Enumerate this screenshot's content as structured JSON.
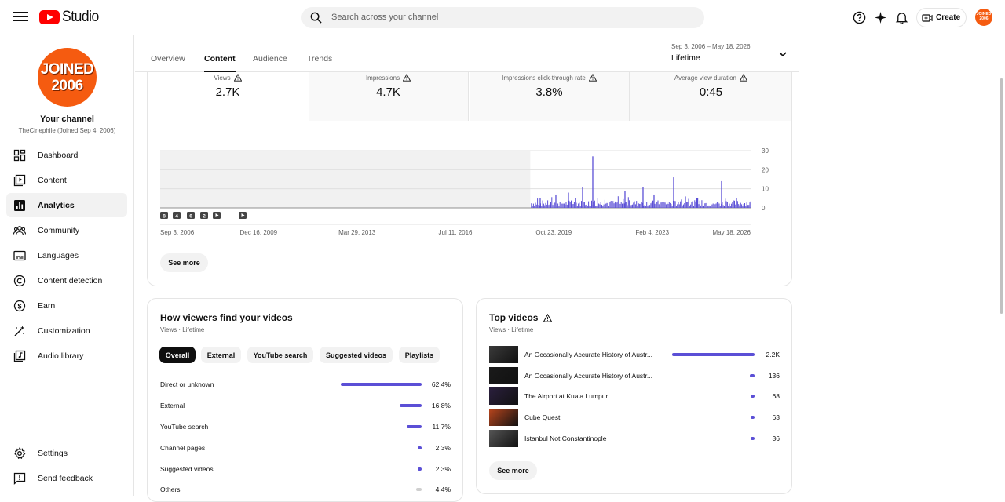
{
  "header": {
    "app_name": "Studio",
    "search_placeholder": "Search across your channel",
    "create_label": "Create",
    "avatar_text": "JOINED 2006"
  },
  "sidebar": {
    "avatar_line1": "JOINED",
    "avatar_line2": "2006",
    "title": "Your channel",
    "subtitle": "TheCinephile (Joined Sep 4, 2006)",
    "items": [
      {
        "label": "Dashboard",
        "icon": "dashboard-icon"
      },
      {
        "label": "Content",
        "icon": "content-icon"
      },
      {
        "label": "Analytics",
        "icon": "analytics-icon",
        "active": true
      },
      {
        "label": "Community",
        "icon": "community-icon"
      },
      {
        "label": "Languages",
        "icon": "languages-icon"
      },
      {
        "label": "Content detection",
        "icon": "copyright-icon"
      },
      {
        "label": "Earn",
        "icon": "earn-icon"
      },
      {
        "label": "Customization",
        "icon": "customization-icon"
      },
      {
        "label": "Audio library",
        "icon": "audio-library-icon"
      }
    ],
    "bottom": [
      {
        "label": "Settings",
        "icon": "settings-icon"
      },
      {
        "label": "Send feedback",
        "icon": "feedback-icon"
      }
    ]
  },
  "tabs": [
    "Overview",
    "Content",
    "Audience",
    "Trends"
  ],
  "active_tab": "Content",
  "date_range": {
    "range": "Sep 3, 2006 – May 18, 2026",
    "label": "Lifetime"
  },
  "metrics": [
    {
      "label": "Views",
      "value": "2.7K"
    },
    {
      "label": "Impressions",
      "value": "4.7K"
    },
    {
      "label": "Impressions click-through rate",
      "value": "3.8%"
    },
    {
      "label": "Average view duration",
      "value": "0:45"
    }
  ],
  "chart_data": {
    "type": "bar",
    "series": [
      {
        "name": "Views"
      }
    ],
    "x_ticks": [
      "Sep 3, 2006",
      "Dec 16, 2009",
      "Mar 29, 2013",
      "Jul 11, 2016",
      "Oct 23, 2019",
      "Feb 4, 2023",
      "May 18, 2026"
    ],
    "y_ticks": [
      30,
      20,
      10,
      0
    ],
    "ylim": [
      0,
      30
    ],
    "data_start": "Oct 23, 2019",
    "spikes": [
      {
        "date": "Nov 2019",
        "value": 5
      },
      {
        "date": "Feb 2020",
        "value": 7
      },
      {
        "date": "Nov 2020",
        "value": 8
      },
      {
        "date": "Apr 2021",
        "value": 11
      },
      {
        "date": "Oct 2021",
        "value": 27
      },
      {
        "date": "Dec 2022",
        "value": 9
      },
      {
        "date": "Aug 2023",
        "value": 11
      },
      {
        "date": "Feb 2024",
        "value": 7
      },
      {
        "date": "Jun 2024",
        "value": 16
      },
      {
        "date": "Nov 2024",
        "value": 6
      },
      {
        "date": "Mar 2025",
        "value": 5
      },
      {
        "date": "Aug 2025",
        "value": 14
      },
      {
        "date": "Jan 2026",
        "value": 5
      }
    ],
    "baseline_typical": 2,
    "markers": [
      "8",
      "4",
      "6",
      "2"
    ],
    "grid": true
  },
  "main_see_more": "See more",
  "traffic": {
    "title": "How viewers find your videos",
    "subtitle": "Views · Lifetime",
    "chips": [
      "Overall",
      "External",
      "YouTube search",
      "Suggested videos",
      "Playlists"
    ],
    "active_chip": "Overall",
    "rows": [
      {
        "label": "Direct or unknown",
        "pct": "62.4%",
        "value": 62.4
      },
      {
        "label": "External",
        "pct": "16.8%",
        "value": 16.8
      },
      {
        "label": "YouTube search",
        "pct": "11.7%",
        "value": 11.7
      },
      {
        "label": "Channel pages",
        "pct": "2.3%",
        "value": 2.3
      },
      {
        "label": "Suggested videos",
        "pct": "2.3%",
        "value": 2.3
      },
      {
        "label": "Others",
        "pct": "4.4%",
        "value": 4.4,
        "grey": true
      }
    ]
  },
  "top_videos": {
    "title": "Top videos",
    "subtitle": "Views · Lifetime",
    "rows": [
      {
        "title": "An Occasionally Accurate History of Austr...",
        "views": "2.2K",
        "value": 2200
      },
      {
        "title": "An Occasionally Accurate History of Austr...",
        "views": "136",
        "value": 136
      },
      {
        "title": "The Airport at Kuala Lumpur",
        "views": "68",
        "value": 68
      },
      {
        "title": "Cube Quest",
        "views": "63",
        "value": 63
      },
      {
        "title": "Istanbul Not Constantinople",
        "views": "36",
        "value": 36
      }
    ],
    "see_more": "See more"
  },
  "colors": {
    "accent": "#5b4fd6",
    "brand": "#ff0000",
    "avatar": "#f55b10"
  }
}
